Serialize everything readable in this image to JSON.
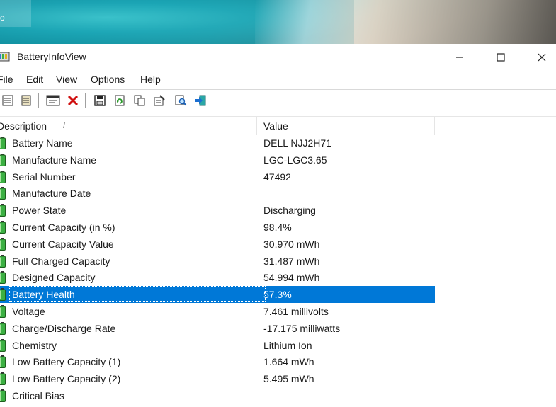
{
  "window": {
    "title": "BatteryInfoView",
    "minimize_glyph": "—",
    "maximize_glyph": "☐",
    "close_glyph": "✕"
  },
  "menu": [
    "File",
    "Edit",
    "View",
    "Options",
    "Help"
  ],
  "toolbar": {
    "icons": [
      "properties-icon",
      "html-report-icon",
      "window-icon",
      "delete-icon",
      "save-icon",
      "refresh-icon",
      "copy-icon",
      "options-icon",
      "find-icon",
      "exit-icon"
    ]
  },
  "columns": {
    "description": "Description",
    "value": "Value",
    "sort_indicator": "/"
  },
  "rows": [
    {
      "description": "Battery Name",
      "value": "DELL NJJ2H71"
    },
    {
      "description": "Manufacture Name",
      "value": "LGC-LGC3.65"
    },
    {
      "description": "Serial Number",
      "value": "47492"
    },
    {
      "description": "Manufacture Date",
      "value": ""
    },
    {
      "description": "Power State",
      "value": "Discharging"
    },
    {
      "description": "Current Capacity (in %)",
      "value": "98.4%"
    },
    {
      "description": "Current Capacity Value",
      "value": "30.970 mWh"
    },
    {
      "description": "Full Charged Capacity",
      "value": "31.487 mWh"
    },
    {
      "description": "Designed Capacity",
      "value": "54.994 mWh"
    },
    {
      "description": "Battery Health",
      "value": "57.3%"
    },
    {
      "description": "Voltage",
      "value": "7.461 millivolts"
    },
    {
      "description": "Charge/Discharge Rate",
      "value": "-17.175 milliwatts"
    },
    {
      "description": "Chemistry",
      "value": "Lithium Ion"
    },
    {
      "description": "Low Battery Capacity (1)",
      "value": "1.664 mWh"
    },
    {
      "description": "Low Battery Capacity (2)",
      "value": "5.495 mWh"
    },
    {
      "description": "Critical Bias",
      "value": ""
    }
  ],
  "selected_row_index": 9,
  "colors": {
    "selection": "#0078d7",
    "battery_fill": "#3cb043"
  }
}
